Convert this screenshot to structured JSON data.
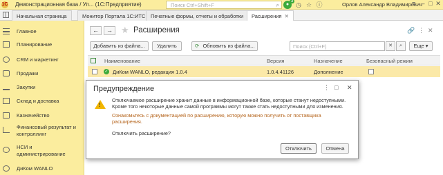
{
  "window": {
    "title": "Демонстрационная база / Уп...   (1С:Предприятие)",
    "search_placeholder": "Поиск Ctrl+Shift+F",
    "notifications_count": "3",
    "user": "Орлов Александр Владимирович"
  },
  "tabs": [
    {
      "label": "Начальная страница"
    },
    {
      "label": "Монитор Портала 1С:ИТС"
    },
    {
      "label": "Печатные формы, отчеты и обработки"
    },
    {
      "label": "Расширения"
    }
  ],
  "sidebar": {
    "items": [
      {
        "label": "Главное",
        "icon": "menu-icon"
      },
      {
        "label": "Планирование",
        "icon": "calendar-icon"
      },
      {
        "label": "CRM и маркетинг",
        "icon": "crm-icon"
      },
      {
        "label": "Продажи",
        "icon": "sales-icon"
      },
      {
        "label": "Закупки",
        "icon": "purchases-icon"
      },
      {
        "label": "Склад и доставка",
        "icon": "warehouse-icon"
      },
      {
        "label": "Казначейство",
        "icon": "treasury-icon"
      },
      {
        "label": "Финансовый результат и",
        "label2": "контроллинг",
        "icon": "finance-icon"
      },
      {
        "label": "НСИ и",
        "label2": "администрирование",
        "icon": "gear-icon"
      },
      {
        "label": "ДиКом WANLO",
        "icon": "dikom-icon"
      }
    ]
  },
  "page": {
    "title": "Расширения",
    "buttons": {
      "add_from_file": "Добавить из файла...",
      "delete": "Удалить",
      "update_from_file": "Обновить из файла...",
      "more": "Еще"
    },
    "search_placeholder": "Поиск (Ctrl+F)"
  },
  "table": {
    "columns": [
      "Наименование",
      "Версия",
      "Назначение",
      "Безопасный режим"
    ],
    "rows": [
      {
        "name": "ДиКом WANLO, редакция 1.0.4",
        "version": "1.0.4.41126",
        "purpose": "Дополнение"
      }
    ]
  },
  "dialog": {
    "title": "Предупреждение",
    "line1": "Отключаемое расширение хранит данные в информационной базе, которые станут недоступными.",
    "line2": "Кроме того некоторые данные самой программы могут также стать недоступными для изменения.",
    "link1": "Ознакомьтесь с документацией по расширению, которую можно получить от поставщика",
    "link2": "расширения.",
    "question": "Отключить расширение?",
    "ok_label": "Отключить",
    "cancel_label": "Отмена"
  }
}
